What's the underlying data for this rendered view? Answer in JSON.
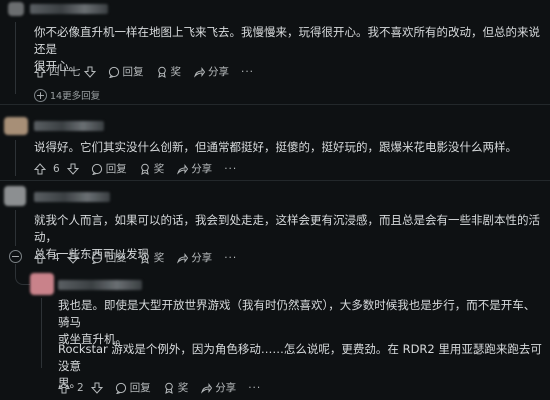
{
  "comments": [
    {
      "body": [
        "你不必像直升机一样在地图上飞来飞去。我慢慢来，玩得很开心。我不喜欢所有的改动，但总的来说还是",
        "很开心。"
      ],
      "votes": "四十七",
      "reply_label": "回复",
      "award_label": "奖",
      "share_label": "分享",
      "more_replies": "14更多回复"
    },
    {
      "body": [
        "说得好。它们其实没什么创新，但通常都挺好，挺傻的，挺好玩的，跟爆米花电影没什么两样。"
      ],
      "votes": "6",
      "reply_label": "回复",
      "award_label": "奖",
      "share_label": "分享"
    },
    {
      "body": [
        "就我个人而言，如果可以的话，我会到处走走，这样会更有沉浸感，而且总是会有一些非剧本性的活动，",
        "总有一些东西可以发现"
      ],
      "votes": "4",
      "reply_label": "回复",
      "award_label": "奖",
      "share_label": "分享"
    },
    {
      "body": [
        "我也是。即使是大型开放世界游戏（我有时仍然喜欢），大多数时候我也是步行，而不是开车、骑马",
        "或坐直升机。"
      ],
      "body2": [
        "Rockstar 游戏是个例外，因为角色移动……怎么说呢，更费劲。在 RDR2 里用亚瑟跑来跑去可没意",
        "思。"
      ],
      "votes": "2",
      "reply_label": "回复",
      "award_label": "奖",
      "share_label": "分享"
    }
  ]
}
